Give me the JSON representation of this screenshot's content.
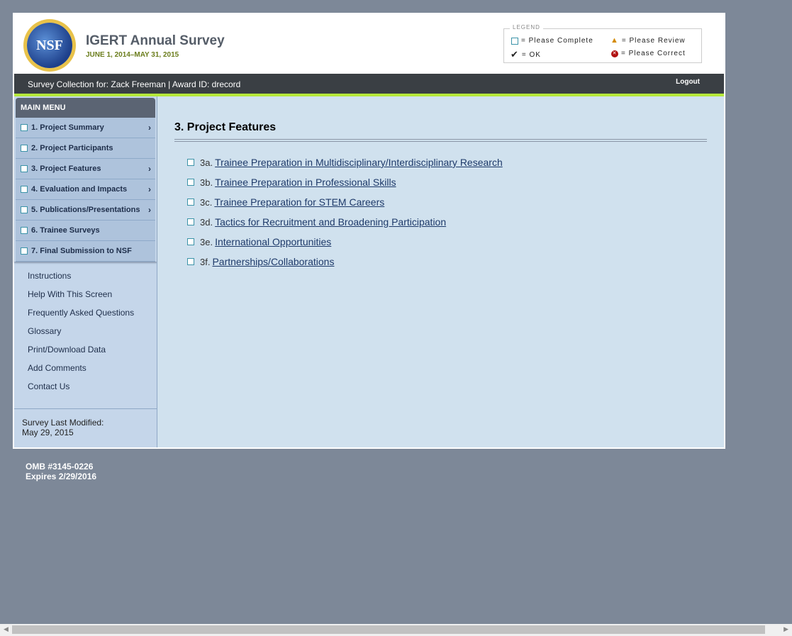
{
  "header": {
    "logo_text": "NSF",
    "title": "IGERT Annual Survey",
    "dates": "JUNE 1, 2014–MAY 31, 2015"
  },
  "legend": {
    "title": "LEGEND",
    "complete": "= Please Complete",
    "review": "= Please Review",
    "ok": "= OK",
    "correct": "= Please Correct"
  },
  "bar": {
    "who": "Survey Collection for: Zack Freeman | Award ID: drecord",
    "logout": "Logout"
  },
  "sidebar": {
    "menu_title": "MAIN MENU",
    "items": [
      {
        "label": "1. Project Summary",
        "chev": true
      },
      {
        "label": "2. Project Participants",
        "chev": false
      },
      {
        "label": "3. Project Features",
        "chev": true
      },
      {
        "label": "4. Evaluation and Impacts",
        "chev": true
      },
      {
        "label": "5. Publications/Presentations",
        "chev": true
      },
      {
        "label": "6. Trainee Surveys",
        "chev": false
      },
      {
        "label": "7. Final Submission to NSF",
        "chev": false
      }
    ],
    "links": [
      "Instructions",
      "Help With This Screen",
      "Frequently Asked Questions",
      "Glossary",
      "Print/Download Data",
      "Add Comments",
      "Contact Us"
    ],
    "modified_label": "Survey Last Modified:",
    "modified_date": "May 29, 2015"
  },
  "main": {
    "title": "3. Project Features",
    "items": [
      {
        "num": "3a.",
        "label": "Trainee Preparation in Multidisciplinary/Interdisciplinary Research"
      },
      {
        "num": "3b.",
        "label": "Trainee Preparation in Professional Skills"
      },
      {
        "num": "3c.",
        "label": "Trainee Preparation for STEM Careers"
      },
      {
        "num": "3d.",
        "label": "Tactics for Recruitment and Broadening Participation"
      },
      {
        "num": "3e.",
        "label": "International Opportunities"
      },
      {
        "num": "3f.",
        "label": "Partnerships/Collaborations"
      }
    ]
  },
  "footer": {
    "omb": "OMB #3145-0226",
    "expires": "Expires 2/29/2016"
  }
}
